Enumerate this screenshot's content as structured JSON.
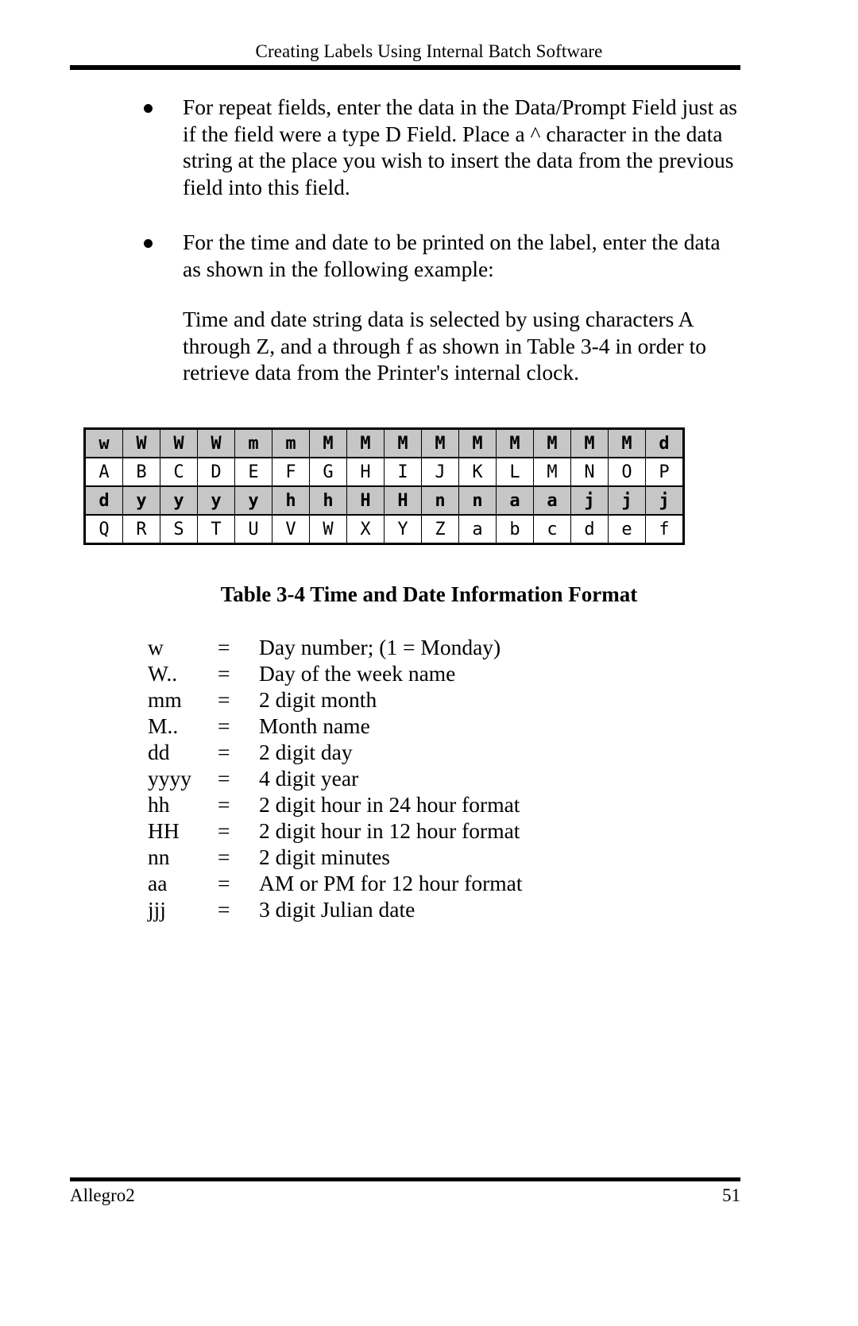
{
  "header": {
    "title": "Creating Labels Using Internal Batch Software"
  },
  "body": {
    "bullets": [
      "For repeat fields, enter the data in the Data/Prompt Field just as if the field were a type D Field. Place a ^ character in the data string at the place you wish to insert the data from the previous field into this field.",
      "For the time and date to be printed on the label, enter the data as shown in the following example:"
    ],
    "paragraph": "Time and date string data is selected by using characters A through Z, and a through f as shown in Table 3-4 in order to retrieve data from the Printer's internal clock."
  },
  "table": {
    "caption": "Table 3-4  Time and Date Information Format",
    "rows": [
      {
        "style": "shade",
        "cells": [
          "w",
          "W",
          "W",
          "W",
          "m",
          "m",
          "M",
          "M",
          "M",
          "M",
          "M",
          "M",
          "M",
          "M",
          "M",
          "d"
        ]
      },
      {
        "style": "plain",
        "cells": [
          "A",
          "B",
          "C",
          "D",
          "E",
          "F",
          "G",
          "H",
          "I",
          "J",
          "K",
          "L",
          "M",
          "N",
          "O",
          "P"
        ]
      },
      {
        "style": "shade",
        "cells": [
          "d",
          "y",
          "y",
          "y",
          "y",
          "h",
          "h",
          "H",
          "H",
          "n",
          "n",
          "a",
          "a",
          "j",
          "j",
          "j"
        ]
      },
      {
        "style": "plain",
        "cells": [
          "Q",
          "R",
          "S",
          "T",
          "U",
          "V",
          "W",
          "X",
          "Y",
          "Z",
          "a",
          "b",
          "c",
          "d",
          "e",
          "f"
        ]
      }
    ]
  },
  "definitions": [
    {
      "term": "w",
      "eq": "=",
      "desc": "Day number; (1 = Monday)"
    },
    {
      "term": "W..",
      "eq": "=",
      "desc": "Day of the week name"
    },
    {
      "term": "mm",
      "eq": "=",
      "desc": "2 digit month"
    },
    {
      "term": "M..",
      "eq": "=",
      "desc": "Month name"
    },
    {
      "term": "dd",
      "eq": "=",
      "desc": "2 digit day"
    },
    {
      "term": "yyyy",
      "eq": "=",
      "desc": "4 digit year"
    },
    {
      "term": "hh",
      "eq": "=",
      "desc": "2 digit hour in 24 hour format"
    },
    {
      "term": "HH",
      "eq": "=",
      "desc": "2 digit hour in 12 hour format"
    },
    {
      "term": "nn",
      "eq": "=",
      "desc": "2 digit minutes"
    },
    {
      "term": "aa",
      "eq": "=",
      "desc": "AM or PM for 12 hour format"
    },
    {
      "term": "jjj",
      "eq": "=",
      "desc": "3 digit Julian date"
    }
  ],
  "footer": {
    "left": "Allegro2",
    "page_number": "51"
  },
  "colors": {
    "text": "#000000",
    "page_background": "#ffffff",
    "table_shade": "#c6c6c6",
    "rule": "#000000"
  }
}
